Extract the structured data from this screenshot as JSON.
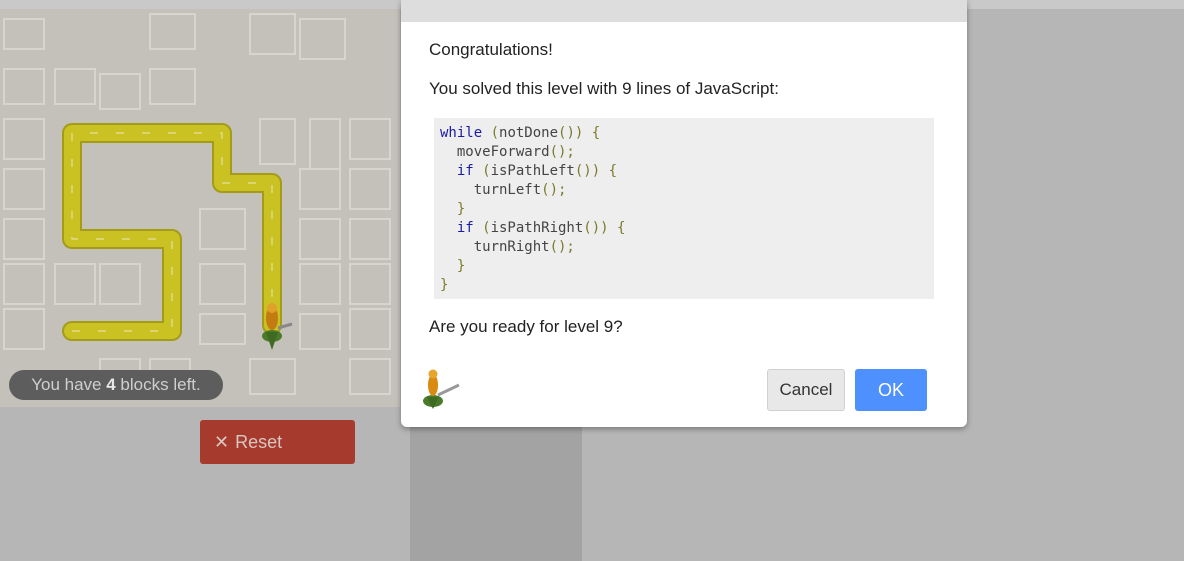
{
  "game": {
    "blocks_left_prefix": "You have ",
    "blocks_left_count": "4",
    "blocks_left_suffix": " blocks left.",
    "reset_label": "Reset",
    "reset_icon": "close-icon"
  },
  "dialog": {
    "congrats": "Congratulations!",
    "solved_text": "You solved this level with 9 lines of JavaScript:",
    "ready_text": "Are you ready for level 9?",
    "cancel_label": "Cancel",
    "ok_label": "OK"
  },
  "code": {
    "l1_kw": "while",
    "l1_a": " (",
    "l1_fn": "notDone",
    "l1_b": "()) {",
    "l2_fn": "moveForward",
    "l2_b": "();",
    "l3_kw": "if",
    "l3_a": " (",
    "l3_fn": "isPathLeft",
    "l3_b": "()) {",
    "l4_fn": "turnLeft",
    "l4_b": "();",
    "l5": "}",
    "l6_kw": "if",
    "l6_a": " (",
    "l6_fn": "isPathRight",
    "l6_b": "()) {",
    "l7_fn": "turnRight",
    "l7_b": "();",
    "l8": "}",
    "l9": "}"
  },
  "colors": {
    "path": "#c9c222",
    "ok": "#4d90fe",
    "reset": "#a63a2c"
  }
}
